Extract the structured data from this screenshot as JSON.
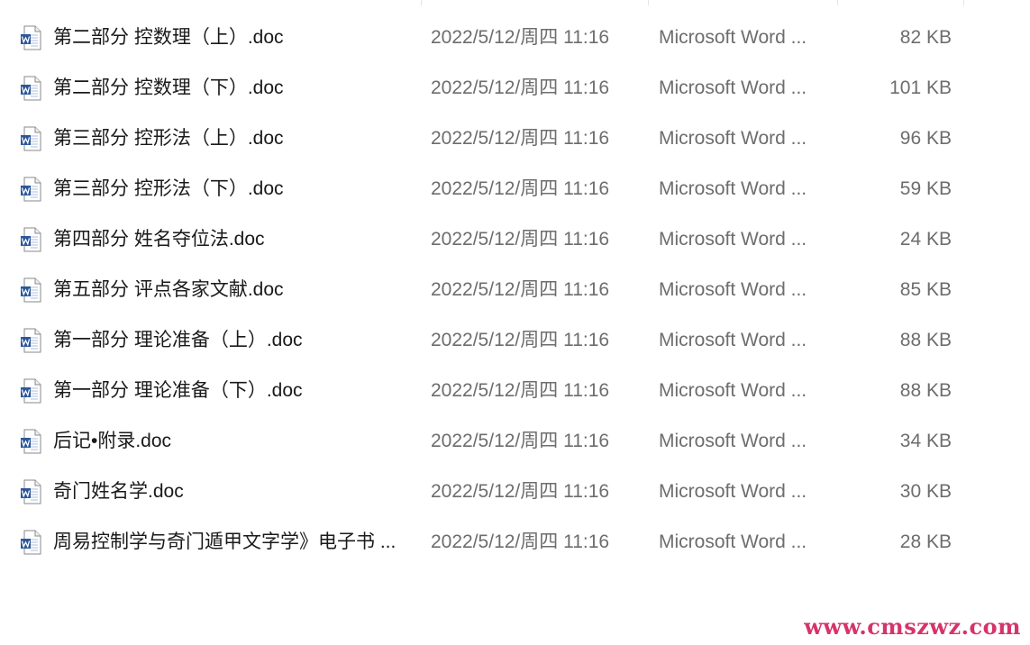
{
  "file_list": {
    "rows": [
      {
        "name": "第二部分 控数理（上）.doc",
        "date": "2022/5/12/周四 11:16",
        "type": "Microsoft Word ...",
        "size": "82 KB",
        "icon": "word-doc-icon"
      },
      {
        "name": "第二部分 控数理（下）.doc",
        "date": "2022/5/12/周四 11:16",
        "type": "Microsoft Word ...",
        "size": "101 KB",
        "icon": "word-doc-icon"
      },
      {
        "name": "第三部分 控形法（上）.doc",
        "date": "2022/5/12/周四 11:16",
        "type": "Microsoft Word ...",
        "size": "96 KB",
        "icon": "word-doc-icon"
      },
      {
        "name": "第三部分 控形法（下）.doc",
        "date": "2022/5/12/周四 11:16",
        "type": "Microsoft Word ...",
        "size": "59 KB",
        "icon": "word-doc-icon"
      },
      {
        "name": "第四部分 姓名夺位法.doc",
        "date": "2022/5/12/周四 11:16",
        "type": "Microsoft Word ...",
        "size": "24 KB",
        "icon": "word-doc-icon"
      },
      {
        "name": "第五部分 评点各家文献.doc",
        "date": "2022/5/12/周四 11:16",
        "type": "Microsoft Word ...",
        "size": "85 KB",
        "icon": "word-doc-icon"
      },
      {
        "name": "第一部分 理论准备（上）.doc",
        "date": "2022/5/12/周四 11:16",
        "type": "Microsoft Word ...",
        "size": "88 KB",
        "icon": "word-doc-icon"
      },
      {
        "name": "第一部分 理论准备（下）.doc",
        "date": "2022/5/12/周四 11:16",
        "type": "Microsoft Word ...",
        "size": "88 KB",
        "icon": "word-doc-icon"
      },
      {
        "name": "后记•附录.doc",
        "date": "2022/5/12/周四 11:16",
        "type": "Microsoft Word ...",
        "size": "34 KB",
        "icon": "word-doc-icon"
      },
      {
        "name": "奇门姓名学.doc",
        "date": "2022/5/12/周四 11:16",
        "type": "Microsoft Word ...",
        "size": "30 KB",
        "icon": "word-doc-icon"
      },
      {
        "name": "周易控制学与奇门遁甲文字学》电子书 ...",
        "date": "2022/5/12/周四 11:16",
        "type": "Microsoft Word ...",
        "size": "28 KB",
        "icon": "word-doc-icon"
      }
    ]
  },
  "watermark": {
    "text": "www.cmszwz.com",
    "color": "#d6336c"
  },
  "colors": {
    "name_text": "#1a1a1a",
    "meta_text": "#6d6d6d",
    "word_blue": "#2b579a"
  }
}
